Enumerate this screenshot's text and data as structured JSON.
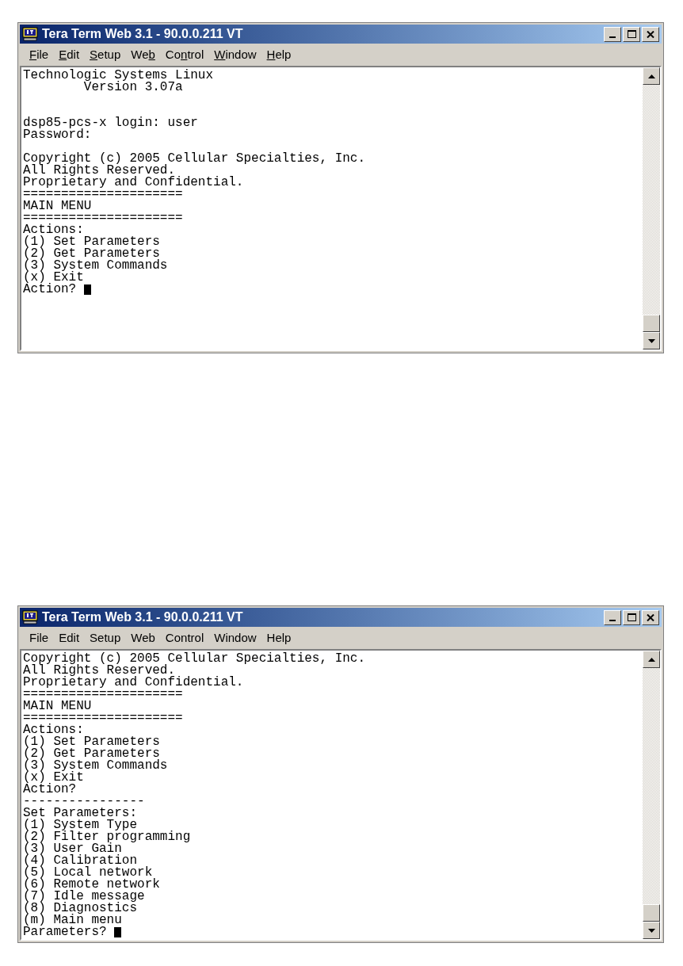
{
  "windows": [
    {
      "title": "Tera Term Web 3.1 - 90.0.0.211 VT",
      "show_access_keys": true,
      "menu": [
        {
          "key": "F",
          "post": "ile"
        },
        {
          "key": "E",
          "post": "dit"
        },
        {
          "key": "S",
          "post": "etup"
        },
        {
          "pre": "We",
          "key": "b"
        },
        {
          "pre": "Co",
          "key": "n",
          "post": "trol"
        },
        {
          "key": "W",
          "post": "indow"
        },
        {
          "key": "H",
          "post": "elp"
        }
      ],
      "lines": [
        {
          "kind": "text",
          "text": "Technologic Systems Linux"
        },
        {
          "kind": "text",
          "text": "        Version 3.07a"
        },
        {
          "kind": "blank"
        },
        {
          "kind": "blank"
        },
        {
          "kind": "text",
          "text": "dsp85-pcs-x login: user"
        },
        {
          "kind": "text",
          "text": "Password:"
        },
        {
          "kind": "blank"
        },
        {
          "kind": "text",
          "text": "Copyright (c) 2005 Cellular Specialties, Inc."
        },
        {
          "kind": "text",
          "text": "All Rights Reserved."
        },
        {
          "kind": "text",
          "text": "Proprietary and Confidential."
        },
        {
          "kind": "text",
          "text": "====================="
        },
        {
          "kind": "text",
          "text": "MAIN MENU"
        },
        {
          "kind": "text",
          "text": "====================="
        },
        {
          "kind": "text",
          "text": "Actions:"
        },
        {
          "kind": "text",
          "text": "(1) Set Parameters"
        },
        {
          "kind": "text",
          "text": "(2) Get Parameters"
        },
        {
          "kind": "text",
          "text": "(3) System Commands"
        },
        {
          "kind": "text",
          "text": "(x) Exit"
        },
        {
          "kind": "prompt",
          "text": "Action? "
        }
      ]
    },
    {
      "title": "Tera Term Web 3.1 - 90.0.0.211 VT",
      "show_access_keys": false,
      "menu": [
        {
          "key": "F",
          "post": "ile"
        },
        {
          "key": "E",
          "post": "dit"
        },
        {
          "key": "S",
          "post": "etup"
        },
        {
          "pre": "We",
          "key": "b"
        },
        {
          "pre": "Co",
          "key": "n",
          "post": "trol"
        },
        {
          "key": "W",
          "post": "indow"
        },
        {
          "key": "H",
          "post": "elp"
        }
      ],
      "lines": [
        {
          "kind": "text",
          "text": "Copyright (c) 2005 Cellular Specialties, Inc."
        },
        {
          "kind": "text",
          "text": "All Rights Reserved."
        },
        {
          "kind": "text",
          "text": "Proprietary and Confidential."
        },
        {
          "kind": "text",
          "text": "====================="
        },
        {
          "kind": "text",
          "text": "MAIN MENU"
        },
        {
          "kind": "text",
          "text": "====================="
        },
        {
          "kind": "text",
          "text": "Actions:"
        },
        {
          "kind": "text",
          "text": "(1) Set Parameters"
        },
        {
          "kind": "text",
          "text": "(2) Get Parameters"
        },
        {
          "kind": "text",
          "text": "(3) System Commands"
        },
        {
          "kind": "text",
          "text": "(x) Exit"
        },
        {
          "kind": "text",
          "text": "Action?"
        },
        {
          "kind": "text",
          "text": "----------------"
        },
        {
          "kind": "text",
          "text": "Set Parameters:"
        },
        {
          "kind": "text",
          "text": "(1) System Type"
        },
        {
          "kind": "text",
          "text": "(2) Filter programming"
        },
        {
          "kind": "text",
          "text": "(3) User Gain"
        },
        {
          "kind": "text",
          "text": "(4) Calibration"
        },
        {
          "kind": "text",
          "text": "(5) Local network"
        },
        {
          "kind": "text",
          "text": "(6) Remote network"
        },
        {
          "kind": "text",
          "text": "(7) Idle message"
        },
        {
          "kind": "text",
          "text": "(8) Diagnostics"
        },
        {
          "kind": "text",
          "text": "(m) Main menu"
        },
        {
          "kind": "prompt",
          "text": "Parameters? "
        }
      ]
    }
  ]
}
